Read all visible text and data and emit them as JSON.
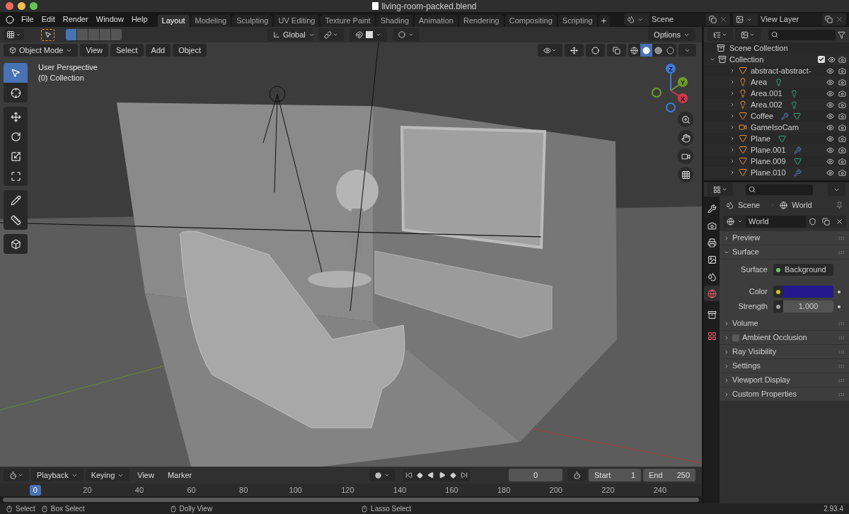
{
  "window": {
    "title": "living-room-packed.blend"
  },
  "menu": [
    "File",
    "Edit",
    "Render",
    "Window",
    "Help"
  ],
  "workspaces": [
    {
      "label": "Layout",
      "selected": true
    },
    {
      "label": "Modeling",
      "selected": false
    },
    {
      "label": "Sculpting",
      "selected": false
    },
    {
      "label": "UV Editing",
      "selected": false
    },
    {
      "label": "Texture Paint",
      "selected": false
    },
    {
      "label": "Shading",
      "selected": false
    },
    {
      "label": "Animation",
      "selected": false
    },
    {
      "label": "Rendering",
      "selected": false
    },
    {
      "label": "Compositing",
      "selected": false
    },
    {
      "label": "Scripting",
      "selected": false
    }
  ],
  "scene": "Scene",
  "view_layer": "View Layer",
  "tool_header": {
    "orientation": "Global",
    "options": "Options",
    "select_modes": [
      {
        "selected": true
      },
      {
        "selected": false
      },
      {
        "selected": false
      },
      {
        "selected": false
      },
      {
        "selected": false
      }
    ],
    "snap_on": false,
    "proportional_edit_on": false
  },
  "viewport_header": {
    "mode": "Object Mode",
    "menus": [
      "View",
      "Select",
      "Add",
      "Object"
    ],
    "gizmos_on": true,
    "overlays_on": true,
    "xray_on": false,
    "shading_modes": [
      {
        "kind": "wireframe",
        "selected": false
      },
      {
        "kind": "solid",
        "selected": true
      },
      {
        "kind": "material",
        "selected": false
      },
      {
        "kind": "rendered",
        "selected": false
      }
    ]
  },
  "overlay_text": [
    "User Perspective",
    "(0) Collection"
  ],
  "gizmo_axes": [
    "Z",
    "Y",
    "X"
  ],
  "tool_groups": [
    {
      "tools": [
        {
          "kind": "select",
          "selected": true
        },
        {
          "kind": "cursor",
          "selected": false
        }
      ]
    },
    {
      "tools": [
        {
          "kind": "move",
          "selected": false
        },
        {
          "kind": "rotate",
          "selected": false
        },
        {
          "kind": "scale",
          "selected": false
        },
        {
          "kind": "transform",
          "selected": false
        }
      ]
    },
    {
      "tools": [
        {
          "kind": "annotate",
          "selected": false
        },
        {
          "kind": "measure",
          "selected": false
        }
      ]
    },
    {
      "tools": [
        {
          "kind": "add-cube",
          "selected": false
        }
      ]
    }
  ],
  "outliner": {
    "root": "Scene Collection",
    "collection": {
      "name": "Collection",
      "checked": true,
      "expanded": true,
      "children": [
        {
          "name": "abstract-abstract-",
          "kind": "mesh",
          "modifier": false,
          "data_shown": false
        },
        {
          "name": "Area",
          "kind": "light",
          "modifier": false,
          "data_shown": true
        },
        {
          "name": "Area.001",
          "kind": "light",
          "modifier": false,
          "data_shown": true
        },
        {
          "name": "Area.002",
          "kind": "light",
          "modifier": false,
          "data_shown": true
        },
        {
          "name": "Coffee",
          "kind": "mesh",
          "modifier": true,
          "data_shown": true
        },
        {
          "name": "GameIsoCam",
          "kind": "camera",
          "modifier": false,
          "data_shown": false
        },
        {
          "name": "Plane",
          "kind": "mesh",
          "modifier": false,
          "data_shown": true
        },
        {
          "name": "Plane.001",
          "kind": "mesh",
          "modifier": true,
          "data_shown": false
        },
        {
          "name": "Plane.009",
          "kind": "mesh",
          "modifier": false,
          "data_shown": true
        },
        {
          "name": "Plane.010",
          "kind": "mesh",
          "modifier": true,
          "data_shown": false
        }
      ]
    }
  },
  "properties": {
    "tabs": [
      {
        "kind": "tool",
        "selected": false
      },
      {
        "kind": "render",
        "selected": false
      },
      {
        "kind": "output",
        "selected": false
      },
      {
        "kind": "view-layer",
        "selected": false
      },
      {
        "kind": "scene",
        "selected": false
      },
      {
        "kind": "world",
        "selected": true
      },
      {
        "kind": "collection",
        "selected": false
      },
      {
        "kind": "texture",
        "selected": false
      }
    ],
    "breadcrumb": [
      "Scene",
      "World"
    ],
    "datablock": "World",
    "panels": [
      {
        "label": "Preview",
        "expanded": false
      },
      {
        "label": "Surface",
        "expanded": true,
        "fields": [
          {
            "label": "Surface",
            "kind": "shader",
            "value": "Background"
          },
          {
            "label": "Color",
            "kind": "color",
            "color": "#25188f"
          },
          {
            "label": "Strength",
            "kind": "number",
            "value": "1.000"
          }
        ]
      },
      {
        "label": "Volume",
        "expanded": false
      },
      {
        "label": "Ambient Occlusion",
        "expanded": false,
        "checked": false
      },
      {
        "label": "Ray Visibility",
        "expanded": false
      },
      {
        "label": "Settings",
        "expanded": false
      },
      {
        "label": "Viewport Display",
        "expanded": false
      },
      {
        "label": "Custom Properties",
        "expanded": false
      }
    ]
  },
  "timeline": {
    "menus": [
      "Playback",
      "Keying",
      "View",
      "Marker"
    ],
    "auto_keying_on": false,
    "preview_range_on": false,
    "current_frame": "0",
    "start_label": "Start",
    "start": "1",
    "end_label": "End",
    "end": "250",
    "ticks": [
      {
        "label": "0",
        "selected": true
      },
      {
        "label": "20",
        "selected": false
      },
      {
        "label": "40",
        "selected": false
      },
      {
        "label": "60",
        "selected": false
      },
      {
        "label": "80",
        "selected": false
      },
      {
        "label": "100",
        "selected": false
      },
      {
        "label": "120",
        "selected": false
      },
      {
        "label": "140",
        "selected": false
      },
      {
        "label": "160",
        "selected": false
      },
      {
        "label": "180",
        "selected": false
      },
      {
        "label": "200",
        "selected": false
      },
      {
        "label": "220",
        "selected": false
      },
      {
        "label": "240",
        "selected": false
      }
    ]
  },
  "status_bar": {
    "hints": [
      "Select",
      "Box Select",
      "Dolly View",
      "Lasso Select"
    ],
    "version": "2.93.4"
  }
}
